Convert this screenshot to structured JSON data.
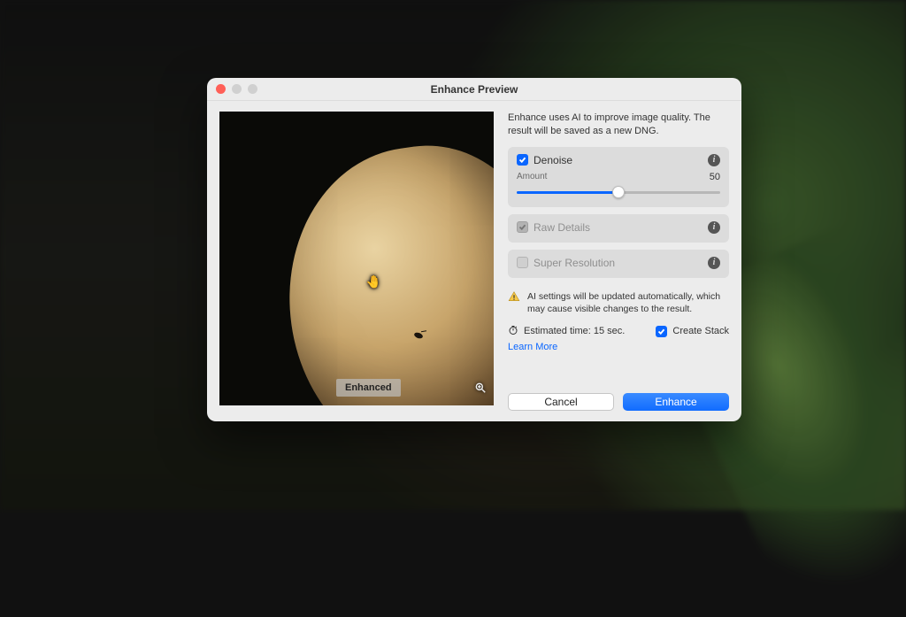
{
  "dialog": {
    "title": "Enhance Preview",
    "description": "Enhance uses AI to improve image quality. The result will be saved as a new DNG."
  },
  "preview": {
    "badge": "Enhanced"
  },
  "denoise": {
    "label": "Denoise",
    "checked": true,
    "amount_label": "Amount",
    "amount_value": "50",
    "amount_percent": 50
  },
  "raw_details": {
    "label": "Raw Details",
    "checked": true,
    "enabled": false
  },
  "super_resolution": {
    "label": "Super Resolution",
    "checked": false,
    "enabled": false
  },
  "warning": {
    "text": "AI settings will be updated automatically, which may cause visible changes to the result."
  },
  "estimate": {
    "label": "Estimated time: 15 sec."
  },
  "create_stack": {
    "label": "Create Stack",
    "checked": true
  },
  "learn_more": "Learn More",
  "buttons": {
    "cancel": "Cancel",
    "enhance": "Enhance"
  },
  "colors": {
    "accent": "#0a66ff"
  }
}
